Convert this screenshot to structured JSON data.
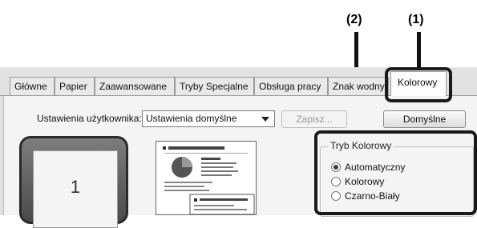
{
  "callouts": {
    "c1": "(1)",
    "c2": "(2)"
  },
  "tabs": [
    {
      "label": "Główne"
    },
    {
      "label": "Papier"
    },
    {
      "label": "Zaawansowane"
    },
    {
      "label": "Tryby Specjalne"
    },
    {
      "label": "Obsługa pracy"
    },
    {
      "label": "Znak wodny"
    },
    {
      "label": "Kolorowy"
    }
  ],
  "user_settings": {
    "label": "Ustawienia użytkownika:",
    "selected": "Ustawienia domyślne",
    "save_button": "Zapisz..."
  },
  "default_button": "Domyślne",
  "preview": {
    "page_number": "1"
  },
  "color_mode": {
    "title": "Tryb Kolorowy",
    "options": [
      {
        "label": "Automatyczny",
        "checked": true
      },
      {
        "label": "Kolorowy",
        "checked": false
      },
      {
        "label": "Czarno-Biały",
        "checked": false
      }
    ]
  }
}
